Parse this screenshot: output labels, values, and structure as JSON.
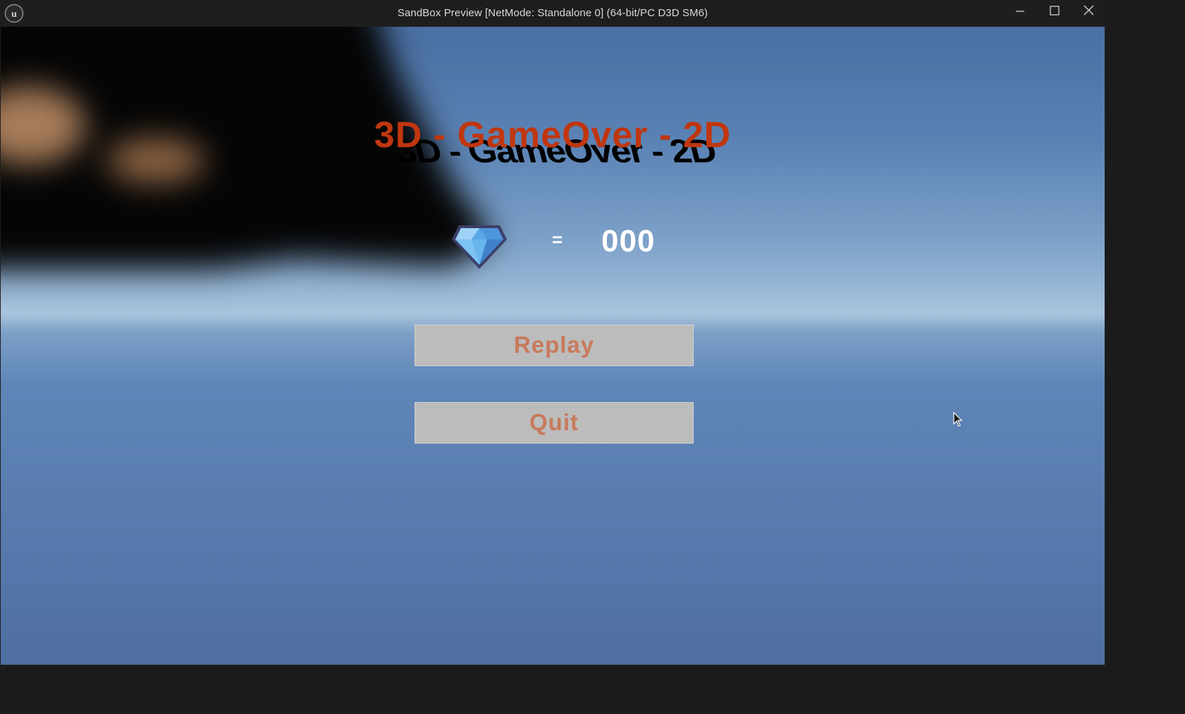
{
  "window": {
    "title": "SandBox Preview [NetMode: Standalone 0]  (64-bit/PC D3D SM6)",
    "logo_icon": "unreal-engine-logo-icon",
    "controls": [
      "minimize-icon",
      "maximize-icon",
      "close-icon"
    ]
  },
  "game_over": {
    "headline": "3D - GameOver - 2D",
    "headline_color": "#c0360f",
    "shadow_text": "3D - GameOver - 2D",
    "gem_icon": "blue-diamond-icon",
    "equals": "=",
    "score": "000"
  },
  "menu": {
    "replay_label": "Replay",
    "quit_label": "Quit",
    "button_text_color": "#c87a5c",
    "button_bg_color": "#bcbcbc"
  },
  "colors": {
    "sky_top": "#4a6fa3",
    "horizon": "#a9c4dc",
    "ground": "#5779ad"
  }
}
